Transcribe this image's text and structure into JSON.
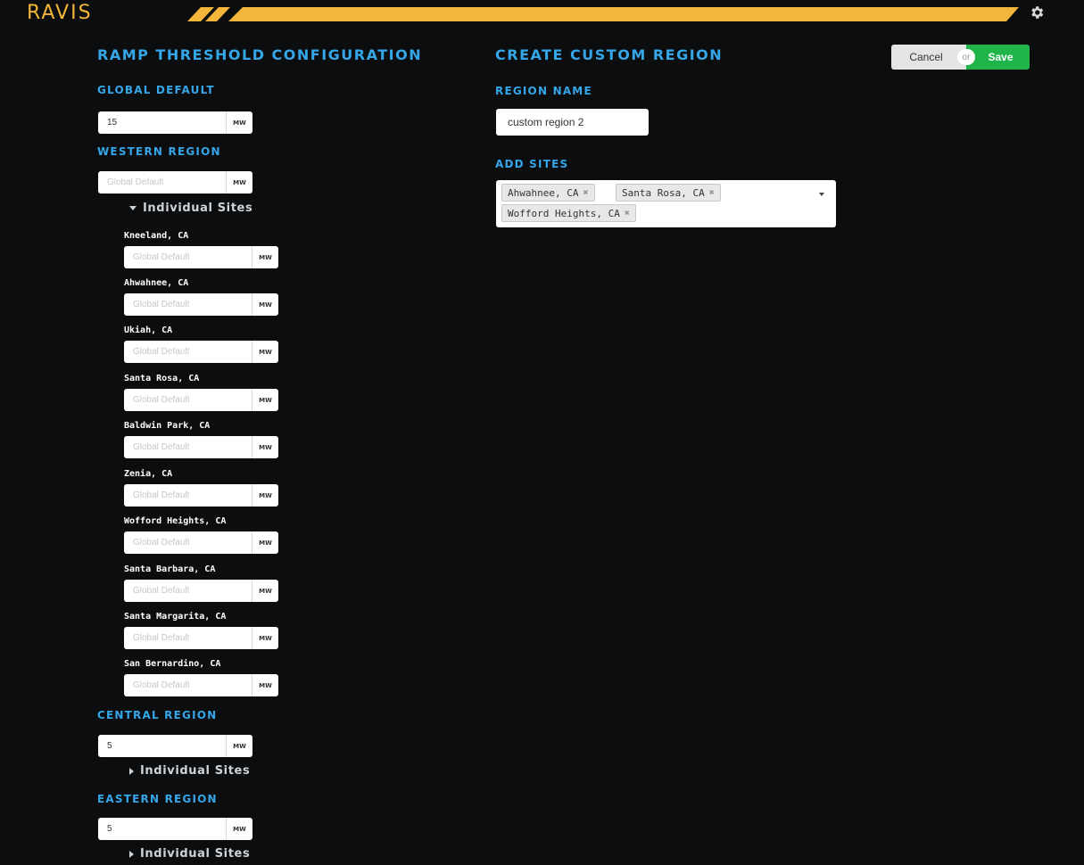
{
  "app": {
    "logo": "RAVIS"
  },
  "colors": {
    "accent": "#35a6e8",
    "brand_gold": "#f3b53a",
    "save_green": "#20b54a"
  },
  "icons": {
    "settings": "gear-icon",
    "expand": "triangle-icon",
    "remove_tag": "x-icon",
    "dropdown": "caret-down-icon"
  },
  "ramp": {
    "title": "Ramp Threshold Configuration",
    "unit": "MW",
    "global_default": {
      "label": "Global Default",
      "value": "15"
    },
    "western": {
      "label": "Western Region",
      "placeholder": "Global Default",
      "toggle_label": "Individual Sites",
      "expanded": true,
      "sites": [
        {
          "name": "Kneeland, CA",
          "placeholder": "Global Default"
        },
        {
          "name": "Ahwahnee, CA",
          "placeholder": "Global Default"
        },
        {
          "name": "Ukiah, CA",
          "placeholder": "Global Default"
        },
        {
          "name": "Santa Rosa, CA",
          "placeholder": "Global Default"
        },
        {
          "name": "Baldwin Park, CA",
          "placeholder": "Global Default"
        },
        {
          "name": "Zenia, CA",
          "placeholder": "Global Default"
        },
        {
          "name": "Wofford Heights, CA",
          "placeholder": "Global Default"
        },
        {
          "name": "Santa Barbara, CA",
          "placeholder": "Global Default"
        },
        {
          "name": "Santa Margarita, CA",
          "placeholder": "Global Default"
        },
        {
          "name": "San Bernardino, CA",
          "placeholder": "Global Default"
        }
      ]
    },
    "central": {
      "label": "Central Region",
      "value": "5",
      "toggle_label": "Individual Sites",
      "expanded": false
    },
    "eastern": {
      "label": "Eastern Region",
      "value": "5",
      "toggle_label": "Individual Sites",
      "expanded": false
    }
  },
  "custom": {
    "title": "Create Custom Region",
    "region_name_label": "Region Name",
    "region_name_value": "custom region 2",
    "add_sites_label": "Add Sites",
    "selected_sites": [
      "Ahwahnee, CA",
      "Santa Rosa, CA",
      "Wofford Heights, CA"
    ],
    "remove_glyph": "✖"
  },
  "actions": {
    "cancel": "Cancel",
    "or": "or",
    "save": "Save"
  }
}
